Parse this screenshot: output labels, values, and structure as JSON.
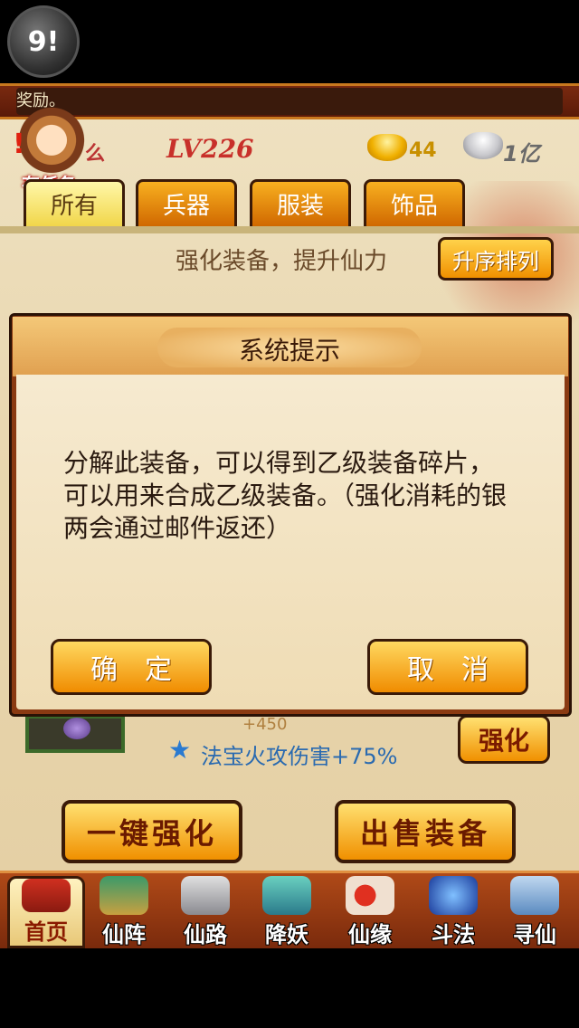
{
  "top": {
    "app_button_label": "9!"
  },
  "marquee": {
    "text": "奖励。"
  },
  "player": {
    "task_label": "有任务",
    "name_fragment": "么",
    "level": "LV226",
    "gold": "44",
    "silver": "1亿"
  },
  "tabs": [
    {
      "label": "所有",
      "active": true
    },
    {
      "label": "兵器",
      "active": false
    },
    {
      "label": "服装",
      "active": false
    },
    {
      "label": "饰品",
      "active": false
    }
  ],
  "toolbar": {
    "hint": "强化装备，提升仙力",
    "sort_label": "升序排列"
  },
  "item": {
    "stat_small": "+450",
    "stat_main": "法宝火攻伤害+75%",
    "enhance_label": "强化"
  },
  "actions": {
    "one_click_enhance": "一键强化",
    "sell_equipment": "出售装备"
  },
  "nav": [
    {
      "label": "首页",
      "icon": "palace-icon"
    },
    {
      "label": "仙阵",
      "icon": "formation-icon"
    },
    {
      "label": "仙路",
      "icon": "crossed-swords-icon"
    },
    {
      "label": "降妖",
      "icon": "demon-icon"
    },
    {
      "label": "仙缘",
      "icon": "crane-icon"
    },
    {
      "label": "斗法",
      "icon": "blue-flame-icon"
    },
    {
      "label": "寻仙",
      "icon": "gourd-icon"
    }
  ],
  "dialog": {
    "title": "系统提示",
    "message": "分解此装备，可以得到乙级装备碎片，可以用来合成乙级装备。（强化消耗的银两会通过邮件返还）",
    "confirm": "确定",
    "cancel": "取消"
  },
  "colors": {
    "accent_orange": "#f09000",
    "dialog_brown": "#8a3a12",
    "stat_blue": "#2a6ab0"
  }
}
